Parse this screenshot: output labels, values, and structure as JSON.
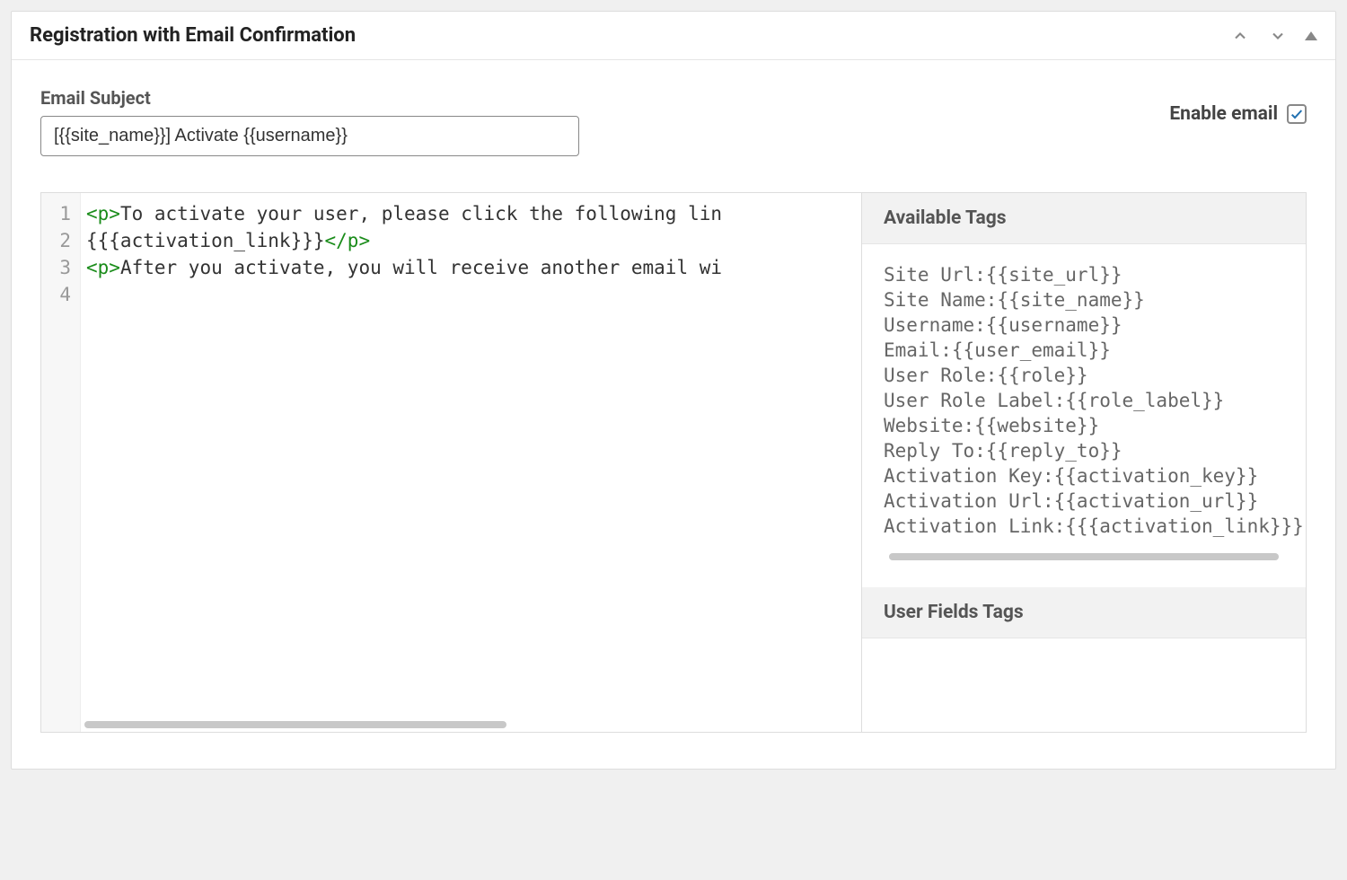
{
  "panel": {
    "title": "Registration with Email Confirmation"
  },
  "subject": {
    "label": "Email Subject",
    "value": "[{{site_name}}] Activate {{username}}"
  },
  "enable": {
    "label": "Enable email",
    "checked": true
  },
  "editor": {
    "lines": [
      {
        "n": "1",
        "pre_tag": "<p>",
        "text": "To activate your user, please click the following lin"
      },
      {
        "n": "2",
        "pre_tag": "",
        "text": "{{{activation_link}}}",
        "post_tag": "</p>"
      },
      {
        "n": "3",
        "pre_tag": "<p>",
        "text": "After you activate, you will receive another email wi"
      },
      {
        "n": "4",
        "pre_tag": "",
        "text": ""
      }
    ]
  },
  "tags": {
    "header": "Available Tags",
    "items": [
      {
        "label": "Site Url:",
        "tag": "{{site_url}}"
      },
      {
        "label": "Site Name:",
        "tag": "{{site_name}}"
      },
      {
        "label": "Username:",
        "tag": "{{username}}"
      },
      {
        "label": "Email:",
        "tag": "{{user_email}}"
      },
      {
        "label": "User Role:",
        "tag": "{{role}}"
      },
      {
        "label": "User Role Label:",
        "tag": "{{role_label}}"
      },
      {
        "label": "Website:",
        "tag": "{{website}}"
      },
      {
        "label": "Reply To:",
        "tag": "{{reply_to}}"
      },
      {
        "label": "Activation Key:",
        "tag": "{{activation_key}}"
      },
      {
        "label": "Activation Url:",
        "tag": "{{activation_url}}"
      },
      {
        "label": "Activation Link:",
        "tag": "{{{activation_link}}}"
      }
    ]
  },
  "user_fields": {
    "header": "User Fields Tags"
  }
}
